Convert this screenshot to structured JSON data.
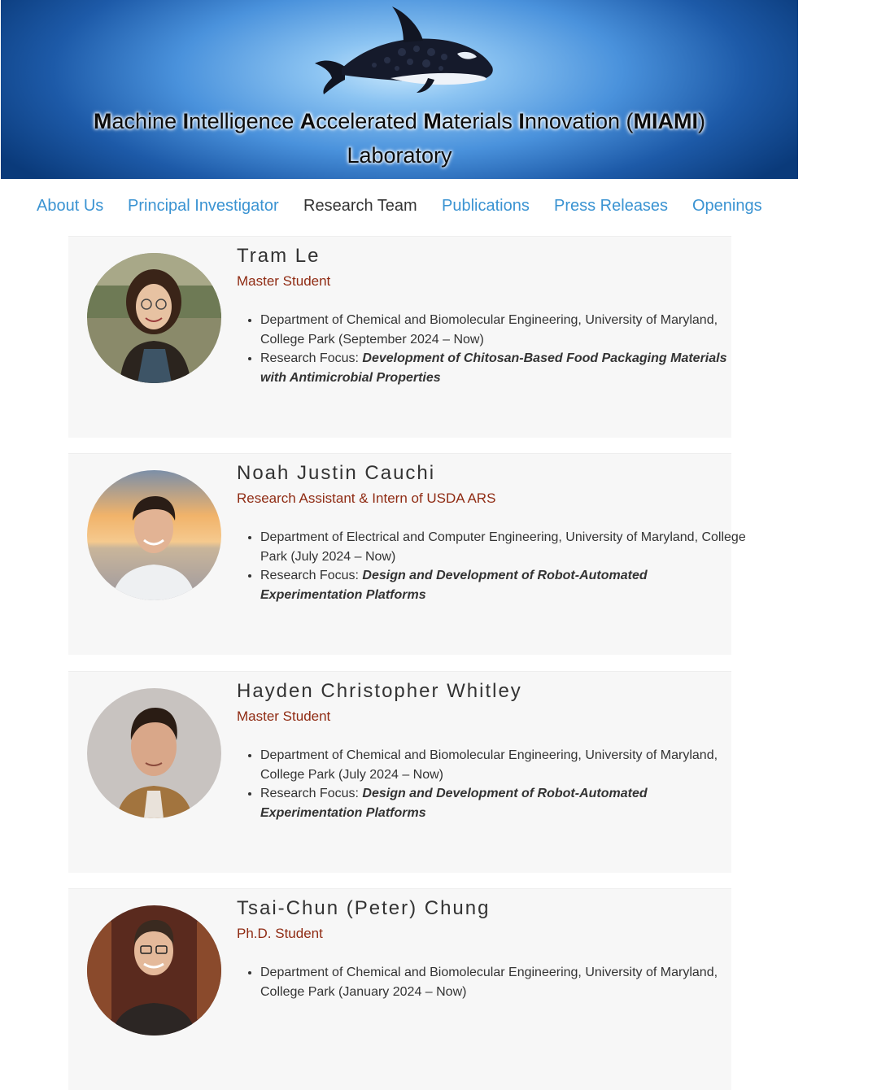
{
  "banner": {
    "title_line1_parts": [
      {
        "text": "M",
        "bold": true
      },
      {
        "text": "achine ",
        "bold": false
      },
      {
        "text": "I",
        "bold": true
      },
      {
        "text": "ntelligence ",
        "bold": false
      },
      {
        "text": "A",
        "bold": true
      },
      {
        "text": "ccelerated ",
        "bold": false
      },
      {
        "text": "M",
        "bold": true
      },
      {
        "text": "aterials ",
        "bold": false
      },
      {
        "text": "I",
        "bold": true
      },
      {
        "text": "nnovation (",
        "bold": false
      },
      {
        "text": "MIAMI",
        "bold": true
      },
      {
        "text": ")",
        "bold": false
      }
    ],
    "title_line2": "Laboratory",
    "logo": "orca-icon"
  },
  "nav": {
    "items": [
      {
        "label": "About Us",
        "active": false
      },
      {
        "label": "Principal Investigator",
        "active": false
      },
      {
        "label": "Research Team",
        "active": true
      },
      {
        "label": "Publications",
        "active": false
      },
      {
        "label": "Press Releases",
        "active": false
      },
      {
        "label": "Openings",
        "active": false
      }
    ]
  },
  "colors": {
    "link": "#3a93d2",
    "active_link": "#333333",
    "role": "#8f2b13",
    "card_bg": "#f7f7f7",
    "text": "#333333"
  },
  "members": [
    {
      "name": "Tram Le",
      "role": "Master Student",
      "photo": "portrait-tram-le",
      "department": "Department of Chemical and Biomolecular Engineering, University of Maryland, College Park (September 2024 – Now)",
      "focus_label": "Research Focus: ",
      "focus": "Development of Chitosan-Based Food Packaging Materials with Antimicrobial Properties"
    },
    {
      "name": "Noah Justin Cauchi",
      "role": "Research Assistant & Intern of USDA ARS",
      "photo": "portrait-noah-justin-cauchi",
      "department": "Department of Electrical and Computer Engineering, University of Maryland, College Park (July 2024 – Now)",
      "focus_label": "Research Focus: ",
      "focus": "Design and Development of Robot-Automated Experimentation Platforms"
    },
    {
      "name": "Hayden Christopher Whitley",
      "role": "Master Student",
      "photo": "portrait-hayden-christopher-whitley",
      "department": "Department of Chemical and Biomolecular Engineering, University of Maryland, College Park (July 2024 – Now)",
      "focus_label": "Research Focus: ",
      "focus": "Design and Development of Robot-Automated Experimentation Platforms"
    },
    {
      "name": "Tsai-Chun (Peter) Chung",
      "role": "Ph.D. Student",
      "photo": "portrait-tsai-chun-peter-chung",
      "department": "Department of Chemical and Biomolecular Engineering, University of Maryland, College Park (January 2024 – Now)"
    }
  ]
}
